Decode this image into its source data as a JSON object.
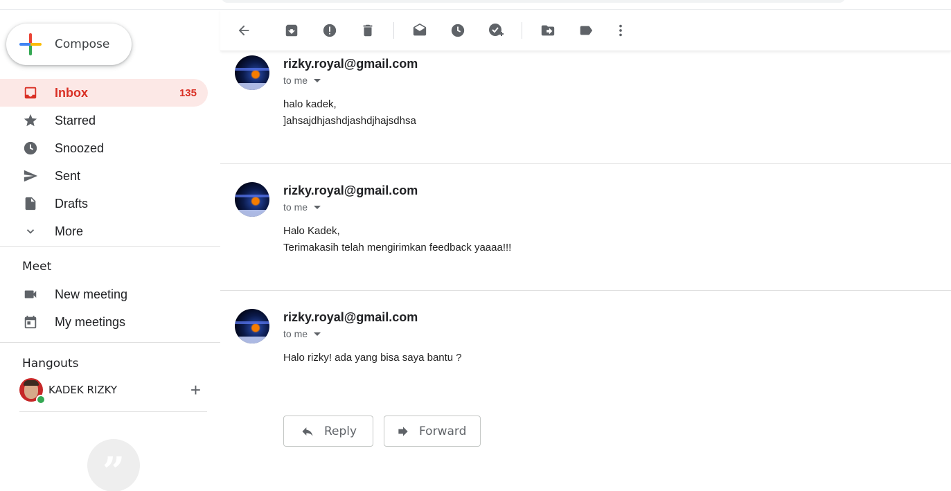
{
  "compose": {
    "label": "Compose"
  },
  "nav": {
    "items": [
      {
        "label": "Inbox",
        "count": "135",
        "icon": "inbox-icon"
      },
      {
        "label": "Starred",
        "icon": "star-icon"
      },
      {
        "label": "Snoozed",
        "icon": "clock-icon"
      },
      {
        "label": "Sent",
        "icon": "send-icon"
      },
      {
        "label": "Drafts",
        "icon": "draft-icon"
      },
      {
        "label": "More",
        "icon": "chevron-down-icon"
      }
    ]
  },
  "meet": {
    "title": "Meet",
    "items": [
      {
        "label": "New meeting",
        "icon": "video-camera-icon"
      },
      {
        "label": "My meetings",
        "icon": "calendar-icon"
      }
    ]
  },
  "hangouts": {
    "title": "Hangouts",
    "user": "KADEK RIZKY"
  },
  "toolbar": {
    "icons": [
      "back-arrow-icon",
      "archive-icon",
      "report-spam-icon",
      "delete-icon",
      "mark-unread-icon",
      "snooze-icon",
      "add-to-tasks-icon",
      "move-to-icon",
      "label-icon",
      "more-vert-icon"
    ]
  },
  "messages": [
    {
      "sender": "rizky.royal@gmail.com",
      "recipient": "to me",
      "lines": [
        "halo kadek,",
        "]ahsajdhjashdjashdjhajsdhsa"
      ]
    },
    {
      "sender": "rizky.royal@gmail.com",
      "recipient": "to me",
      "lines": [
        "Halo Kadek,",
        "Terimakasih telah mengirimkan feedback yaaaa!!!"
      ]
    },
    {
      "sender": "rizky.royal@gmail.com",
      "recipient": "to me",
      "lines": [
        "Halo rizky! ada yang bisa saya bantu ?"
      ]
    }
  ],
  "actions": {
    "reply": "Reply",
    "forward": "Forward"
  },
  "colors": {
    "accent_red": "#d93025",
    "active_bg": "#fce8e6",
    "icon_gray": "#5f6368"
  }
}
